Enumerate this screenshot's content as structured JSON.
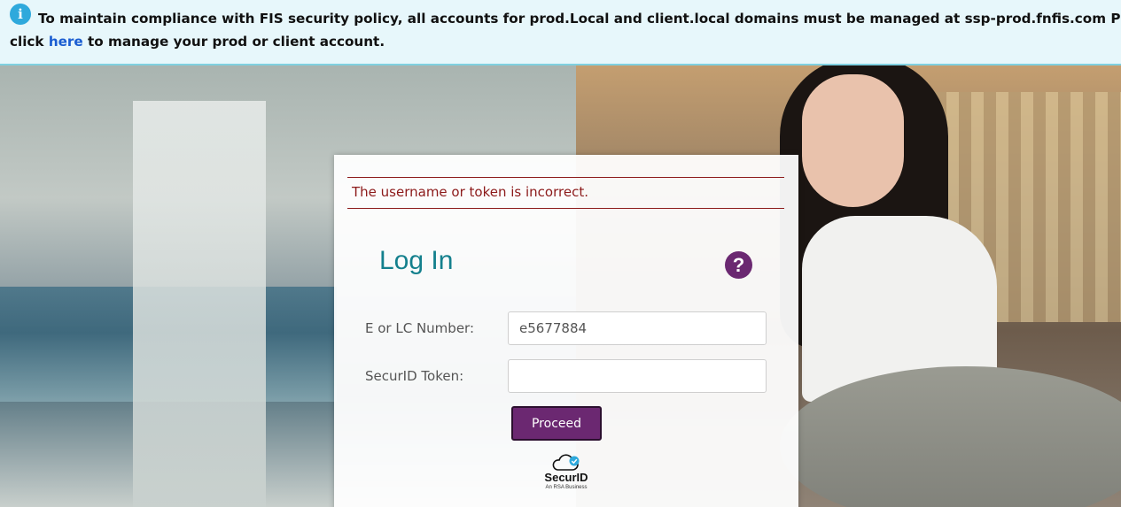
{
  "banner": {
    "text_before_link": "To maintain compliance with FIS security policy, all accounts for prod.Local and client.local domains must be managed at ssp-prod.fnfis.com Please click ",
    "link_text": "here",
    "text_after_link": " to manage your prod or client account.",
    "info_glyph": "i"
  },
  "login": {
    "error_message": "The username or token is incorrect.",
    "title": "Log In",
    "help_glyph": "?",
    "username_label": "E or LC Number:",
    "username_value": "e5677884",
    "token_label": "SecurID Token:",
    "token_value": "",
    "proceed_label": "Proceed"
  },
  "logo": {
    "name": "SecurID",
    "tagline": "An RSA Business"
  },
  "colors": {
    "accent_teal": "#14808d",
    "brand_purple": "#6b2871",
    "error_red": "#8c1a1a",
    "banner_bg": "#e7f7fb",
    "link_blue": "#1a5dd1"
  },
  "icons": {
    "info": "info-icon",
    "help": "help-question-icon",
    "cloud": "cloud-check-icon"
  }
}
